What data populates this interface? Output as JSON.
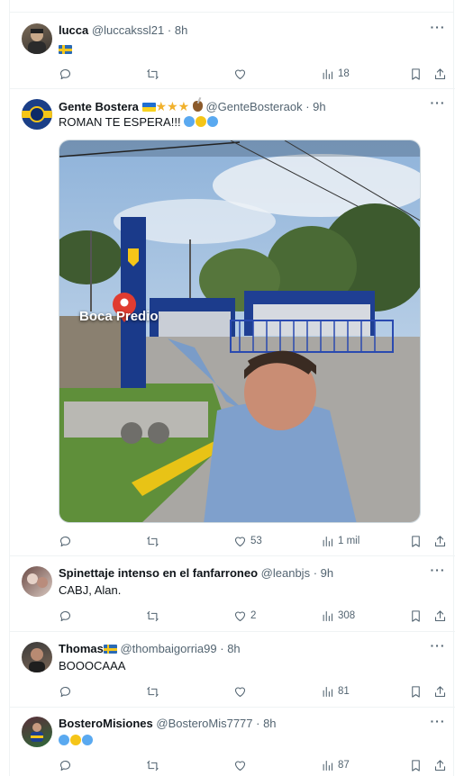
{
  "tweets": [
    {
      "name": "lucca",
      "handle": "@luccakssl21",
      "time": "· 8h",
      "text": "",
      "flag": "sweden",
      "stats": {
        "reply": "",
        "retweet": "",
        "like": "",
        "views": "18"
      }
    },
    {
      "name": "Gente Bostera",
      "handle": "@GenteBosteraok",
      "time": "· 9h",
      "text": "ROMAN TE ESPERA!!!",
      "media_label": "Boca Predio",
      "stats": {
        "reply": "",
        "retweet": "",
        "like": "53",
        "views": "1 mil"
      }
    },
    {
      "name": "Spinettaje intenso en el fanfarroneo",
      "handle": "@leanbjs",
      "time": "· 9h",
      "text": "CABJ, Alan.",
      "stats": {
        "reply": "",
        "retweet": "",
        "like": "2",
        "views": "308"
      }
    },
    {
      "name": "Thomas",
      "handle": "@thombaigorria99",
      "time": "· 8h",
      "text": "BOOOCAAA",
      "stats": {
        "reply": "",
        "retweet": "",
        "like": "",
        "views": "81"
      }
    },
    {
      "name": "BosteroMisiones",
      "handle": "@BosteroMis7777",
      "time": "· 8h",
      "text": "",
      "stats": {
        "reply": "",
        "retweet": "",
        "like": "",
        "views": "87"
      }
    }
  ],
  "icons": {
    "reply": "reply-icon",
    "retweet": "retweet-icon",
    "like": "heart-icon",
    "views": "views-icon",
    "bookmark": "bookmark-icon",
    "share": "share-icon",
    "more": "more-icon"
  },
  "colors": {
    "accent": "#1d9bf0",
    "muted": "#536471",
    "heart_blue": "#5aa9f0",
    "heart_yellow": "#f5c518"
  }
}
